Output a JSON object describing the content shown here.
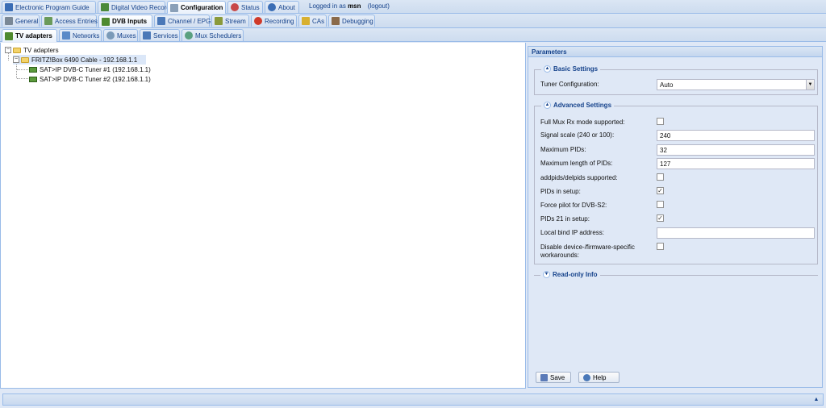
{
  "top_tabs": [
    {
      "label": "Electronic Program Guide"
    },
    {
      "label": "Digital Video Recorder"
    },
    {
      "label": "Configuration"
    },
    {
      "label": "Status"
    },
    {
      "label": "About"
    }
  ],
  "login": {
    "prefix": "Logged in as",
    "user": "msn",
    "logout": "(logout)"
  },
  "config_tabs": [
    {
      "label": "General"
    },
    {
      "label": "Access Entries"
    },
    {
      "label": "DVB Inputs"
    },
    {
      "label": "Channel / EPG"
    },
    {
      "label": "Stream"
    },
    {
      "label": "Recording"
    },
    {
      "label": "CAs"
    },
    {
      "label": "Debugging"
    }
  ],
  "dvb_tabs": [
    {
      "label": "TV adapters"
    },
    {
      "label": "Networks"
    },
    {
      "label": "Muxes"
    },
    {
      "label": "Services"
    },
    {
      "label": "Mux Schedulers"
    }
  ],
  "tree": {
    "root": "TV adapters",
    "device": "FRITZ!Box 6490 Cable - 192.168.1.1",
    "tuners": [
      "SAT>IP DVB-C Tuner #1 (192.168.1.1)",
      "SAT>IP DVB-C Tuner #2 (192.168.1.1)"
    ]
  },
  "params": {
    "title": "Parameters",
    "basic": {
      "legend": "Basic Settings",
      "tuner_config_label": "Tuner Configuration:",
      "tuner_config_value": "Auto"
    },
    "advanced": {
      "legend": "Advanced Settings",
      "full_mux_label": "Full Mux Rx mode supported:",
      "full_mux_checked": false,
      "signal_scale_label": "Signal scale (240 or 100):",
      "signal_scale_value": "240",
      "max_pids_label": "Maximum PIDs:",
      "max_pids_value": "32",
      "max_len_pids_label": "Maximum length of PIDs:",
      "max_len_pids_value": "127",
      "addpids_label": "addpids/delpids supported:",
      "addpids_checked": false,
      "pids_setup_label": "PIDs in setup:",
      "pids_setup_checked": true,
      "force_pilot_label": "Force pilot for DVB-S2:",
      "force_pilot_checked": false,
      "pids21_label": "PIDs 21 in setup:",
      "pids21_checked": true,
      "local_bind_label": "Local bind IP address:",
      "local_bind_value": "",
      "disable_workarounds_label": "Disable device-/firmware-specific workarounds:",
      "disable_workarounds_checked": false
    },
    "readonly": {
      "legend": "Read-only Info"
    },
    "save_label": "Save",
    "help_label": "Help"
  },
  "colors": {
    "accent": "#15428b",
    "border": "#99bbe8",
    "background": "#dfe8f6"
  }
}
